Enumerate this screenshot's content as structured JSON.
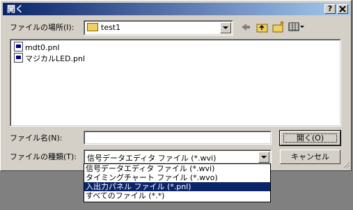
{
  "window": {
    "title": "開く",
    "help_button": "?",
    "close_button": "X"
  },
  "look_in": {
    "label": "ファイルの場所(I):",
    "value": "test1"
  },
  "toolbar": {
    "icons": [
      "back-arrow-icon",
      "up-folder-icon",
      "new-folder-icon",
      "view-menu-icon"
    ]
  },
  "files": [
    {
      "name": "mdt0.pnl",
      "icon": "pnl-file-icon"
    },
    {
      "name": "マジカルLED.pnl",
      "icon": "pnl-file-icon"
    }
  ],
  "filename": {
    "label": "ファイル名(N):",
    "value": ""
  },
  "filetype": {
    "label": "ファイルの種類(T):",
    "value": "信号データエディタ ファイル (*.wvi)",
    "options": [
      "信号データエディタ ファイル (*.wvi)",
      "タイミングチャート ファイル (*.wvo)",
      "入出力パネル ファイル (*.pnl)",
      "すべてのファイル (*.*)"
    ],
    "highlighted_index": 2
  },
  "buttons": {
    "open": "開く(O)",
    "cancel": "キャンセル"
  }
}
